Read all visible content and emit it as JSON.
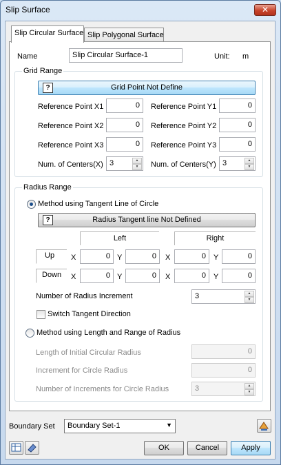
{
  "window": {
    "title": "Slip Surface",
    "close_label": "✕"
  },
  "tabs": [
    {
      "label": "Slip Circular Surface",
      "active": true
    },
    {
      "label": "Slip Polygonal Surface",
      "active": false
    }
  ],
  "name_row": {
    "label": "Name",
    "value": "Slip Circular Surface-1",
    "unit_label": "Unit:",
    "unit_value": "m"
  },
  "grid_range": {
    "title": "Grid Range",
    "define_button": "Grid Point Not Define",
    "help_glyph": "?",
    "ref_x1_label": "Reference Point X1",
    "ref_x1": "0",
    "ref_y1_label": "Reference Point Y1",
    "ref_y1": "0",
    "ref_x2_label": "Reference Point X2",
    "ref_x2": "0",
    "ref_y2_label": "Reference Point Y2",
    "ref_y2": "0",
    "ref_x3_label": "Reference Point X3",
    "ref_x3": "0",
    "ref_y3_label": "Reference Point Y3",
    "ref_y3": "0",
    "centers_x_label": "Num. of Centers(X)",
    "centers_x": "3",
    "centers_y_label": "Num. of Centers(Y)",
    "centers_y": "3"
  },
  "radius_range": {
    "title": "Radius Range",
    "method_tangent_label": "Method using Tangent Line of Circle",
    "tangent_button": "Radius Tangent line Not Defined",
    "help_glyph": "?",
    "left_header": "Left",
    "right_header": "Right",
    "x_label": "X",
    "y_label": "Y",
    "up": {
      "label": "Up",
      "left_x": "0",
      "left_y": "0",
      "right_x": "0",
      "right_y": "0"
    },
    "down": {
      "label": "Down",
      "left_x": "0",
      "left_y": "0",
      "right_x": "0",
      "right_y": "0"
    },
    "increment_label": "Number of Radius Increment",
    "increment_value": "3",
    "switch_label": "Switch Tangent Direction",
    "method_length_label": "Method using Length and Range of Radius",
    "initial_radius_label": "Length of Initial Circular Radius",
    "initial_radius": "0",
    "increment_radius_label": "Increment for Circle Radius",
    "increment_radius": "0",
    "num_increments_label": "Number of Increments for Circle Radius",
    "num_increments": "3"
  },
  "boundary": {
    "label": "Boundary Set",
    "value": "Boundary Set-1"
  },
  "buttons": {
    "ok": "OK",
    "cancel": "Cancel",
    "apply": "Apply"
  },
  "icons": {
    "spin_up": "▲",
    "spin_down": "▼",
    "dropdown": "▼"
  }
}
